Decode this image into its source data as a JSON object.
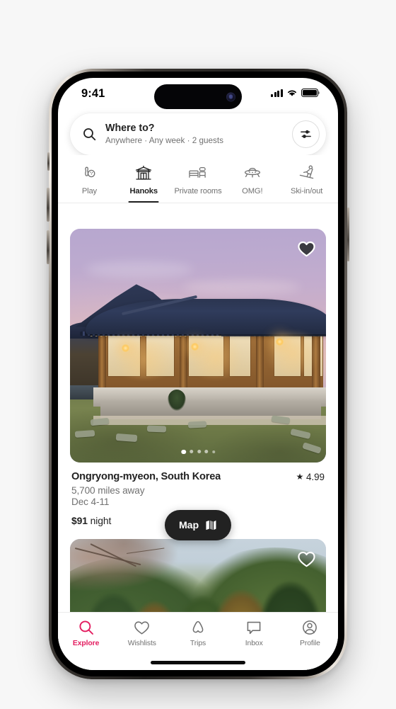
{
  "status_bar": {
    "time": "9:41",
    "cellular_icon": "cellular-signal-icon",
    "wifi_icon": "wifi-icon",
    "battery_icon": "battery-full-icon"
  },
  "search": {
    "icon": "search-icon",
    "title": "Where to?",
    "subtitle": "Anywhere · Any week · 2 guests",
    "placeholder": "Where to?",
    "filter_icon": "filter-sliders-icon"
  },
  "category_tabs": {
    "active_index": 1,
    "items": [
      {
        "label": "Play",
        "icon": "bowling-icon"
      },
      {
        "label": "Hanoks",
        "icon": "hanok-temple-icon"
      },
      {
        "label": "Private rooms",
        "icon": "bed-room-icon"
      },
      {
        "label": "OMG!",
        "icon": "ufo-icon"
      },
      {
        "label": "Ski-in/out",
        "icon": "skier-icon"
      }
    ]
  },
  "listings": [
    {
      "title": "Ongryong-myeon, South Korea",
      "rating": "4.99",
      "star_icon": "star-filled-icon",
      "distance": "5,700 miles away",
      "dates": "Dec 4-11",
      "price_amount": "$91",
      "price_unit": "night",
      "favorite_icon": "heart-filled-icon",
      "photo_dots": 5,
      "photo_active_dot": 1
    },
    {
      "favorite_icon": "heart-outline-icon"
    }
  ],
  "map_button": {
    "label": "Map",
    "icon": "map-icon"
  },
  "bottom_nav": {
    "active_index": 0,
    "active_color": "#E31C5F",
    "items": [
      {
        "label": "Explore",
        "icon": "search-icon"
      },
      {
        "label": "Wishlists",
        "icon": "heart-outline-icon"
      },
      {
        "label": "Trips",
        "icon": "airbnb-bellhop-icon"
      },
      {
        "label": "Inbox",
        "icon": "message-bubble-icon"
      },
      {
        "label": "Profile",
        "icon": "user-circle-icon"
      }
    ]
  }
}
